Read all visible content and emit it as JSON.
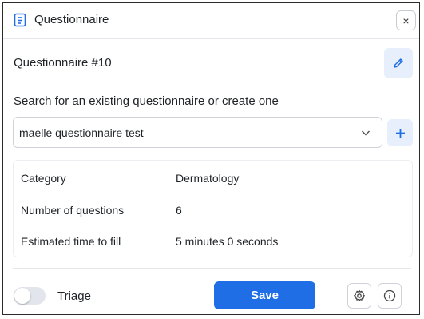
{
  "header": {
    "title": "Questionnaire",
    "close_label": "×"
  },
  "questionnaire": {
    "name": "Questionnaire #10"
  },
  "search": {
    "label": "Search for an existing questionnaire or create one",
    "selected_value": "maelle questionnaire test"
  },
  "details": [
    {
      "key": "Category",
      "value": "Dermatology"
    },
    {
      "key": "Number of questions",
      "value": "6"
    },
    {
      "key": "Estimated time to fill",
      "value": "5 minutes 0 seconds"
    }
  ],
  "footer": {
    "triage_label": "Triage",
    "triage_enabled": false,
    "save_label": "Save"
  },
  "colors": {
    "accent": "#1f6ee6",
    "accent_soft": "#e7effc"
  },
  "icons": {
    "header": "document-list-icon",
    "edit": "pencil-icon",
    "add": "plus-icon",
    "dropdown": "chevron-down-icon",
    "settings": "gear-icon",
    "info": "info-icon"
  }
}
